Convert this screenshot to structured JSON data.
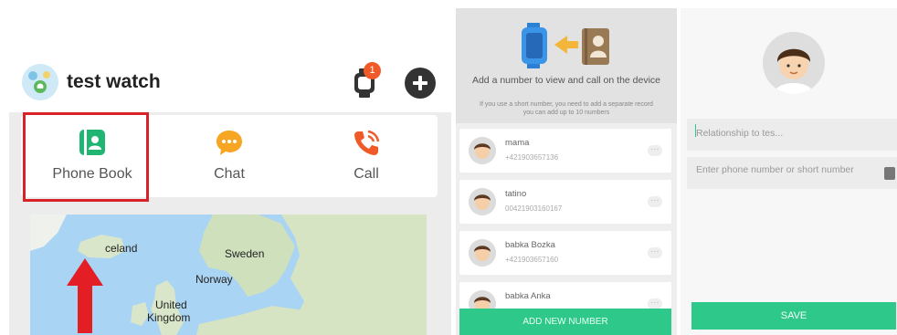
{
  "screen1": {
    "app_title": "test watch",
    "notification_count": "1",
    "icons": {
      "avatar": "avatar-icon",
      "watch": "watch-icon",
      "add": "plus-icon"
    },
    "functions": [
      {
        "label": "Phone Book",
        "icon": "phone-book-icon",
        "color": "#21b573"
      },
      {
        "label": "Chat",
        "icon": "chat-icon",
        "color": "#f6a623"
      },
      {
        "label": "Call",
        "icon": "call-icon",
        "color": "#f05a28"
      }
    ],
    "map_labels": {
      "iceland": "celand",
      "sweden": "Sweden",
      "norway": "Norway",
      "uk_line1": "United",
      "uk_line2": "Kingdom"
    },
    "highlight_color": "#d8222a"
  },
  "screen2": {
    "header_title": "Add a number to view and call on the device",
    "header_subtitle_line1": "If you use a short number, you need to add a separate record",
    "header_subtitle_line2": "you can add up to 10 numbers",
    "contacts": [
      {
        "name": "mama",
        "number": "+421903657136"
      },
      {
        "name": "tatino",
        "number": "00421903160167"
      },
      {
        "name": "babka Bozka",
        "number": "+421903657160"
      },
      {
        "name": "babka Anka",
        "number": ""
      }
    ],
    "add_button": "ADD NEW NUMBER",
    "accent": "#2ec98a"
  },
  "screen3": {
    "relationship_placeholder": "Relationship to tes...",
    "phone_placeholder": "Enter phone number or short number",
    "save_button": "SAVE"
  }
}
